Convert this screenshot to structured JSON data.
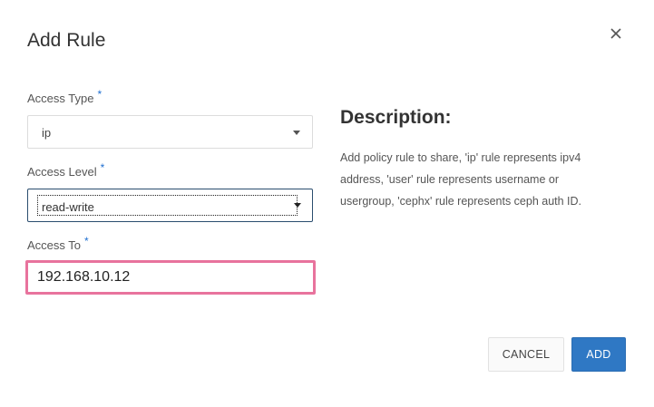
{
  "dialog": {
    "title": "Add Rule",
    "close_icon": "close-icon"
  },
  "fields": {
    "access_type": {
      "label": "Access Type",
      "required_mark": "*",
      "value": "ip"
    },
    "access_level": {
      "label": "Access Level",
      "required_mark": "*",
      "value": "read-write"
    },
    "access_to": {
      "label": "Access To",
      "required_mark": "*",
      "value": "192.168.10.12"
    }
  },
  "description": {
    "title": "Description:",
    "text": "Add policy rule to share, 'ip' rule represents ipv4 address, 'user' rule represents username or usergroup, 'cephx' rule represents ceph auth ID."
  },
  "actions": {
    "cancel_label": "CANCEL",
    "add_label": "ADD"
  },
  "colors": {
    "primary": "#2f78c4",
    "focus_highlight": "#e8739d",
    "required": "#1f6fd0"
  }
}
